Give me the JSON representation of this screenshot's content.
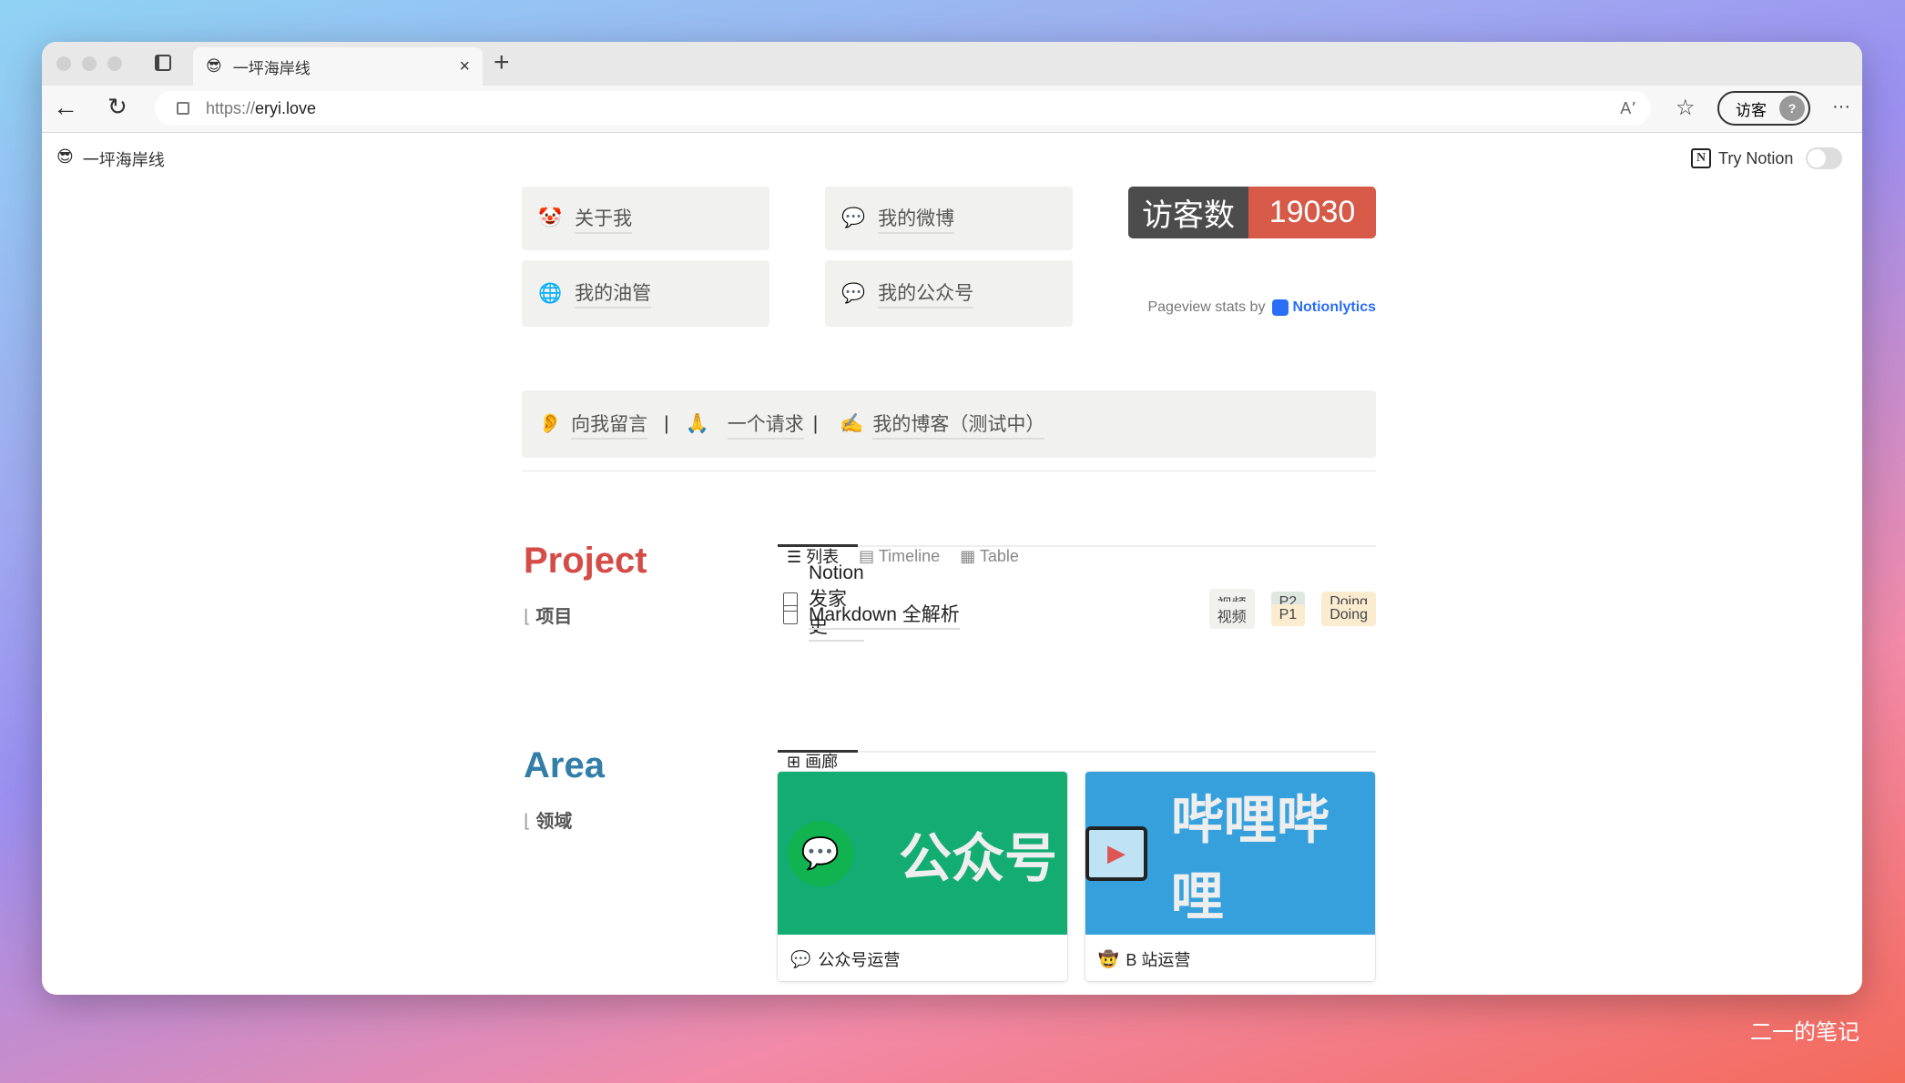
{
  "browser": {
    "tab_title": "一坪海岸线",
    "tab_icon": "😎",
    "url_scheme": "https://",
    "url_host": "eryi.love",
    "profile_label": "访客",
    "profile_avatar": "?",
    "more": "···"
  },
  "page": {
    "title": "一坪海岸线",
    "icon": "😎",
    "try_notion": "Try Notion"
  },
  "links": [
    {
      "icon": "🤡",
      "label": "关于我"
    },
    {
      "icon": "💬",
      "label": "我的微博"
    },
    {
      "icon": "🌐",
      "label": "我的油管"
    },
    {
      "icon": "💬",
      "label": "我的公众号"
    }
  ],
  "visitor": {
    "label": "访客数",
    "count": "19030",
    "pageview_prefix": "Pageview stats by",
    "brand": "Notionlytics",
    "accent": "#2a6ef5"
  },
  "callout": {
    "items": [
      {
        "icon": "👂",
        "label": "向我留言"
      },
      {
        "sep": "|"
      },
      {
        "icon": "🙏",
        "label": "一个请求"
      },
      {
        "sep": "|"
      },
      {
        "icon": "✍️",
        "label": "我的博客（测试中）"
      }
    ]
  },
  "project": {
    "heading": "Project",
    "sub": "项目",
    "color": "#d44c47",
    "tabs": [
      {
        "label": "列表",
        "icon": "list-icon"
      },
      {
        "label": "Timeline",
        "icon": "timeline-icon"
      },
      {
        "label": "Table",
        "icon": "table-icon"
      }
    ],
    "rows": [
      {
        "title": "Notion 发家史",
        "tags": [
          "视频",
          "P2",
          "Doing"
        ]
      },
      {
        "title": "Markdown 全解析",
        "tags": [
          "视频",
          "P1",
          "Doing"
        ]
      }
    ]
  },
  "area": {
    "heading": "Area",
    "sub": "领域",
    "color": "#337ea9",
    "tabs": [
      {
        "label": "画廊",
        "icon": "gallery-icon"
      }
    ],
    "cards": [
      {
        "cover_text": "公众号",
        "caption": "公众号运营",
        "icon": "💬",
        "bg": "#13ad74"
      },
      {
        "cover_text": "哔哩哔哩",
        "caption": "B 站运营",
        "icon": "🤠",
        "bg": "#36a0dc"
      }
    ]
  },
  "watermark": "二一的笔记"
}
